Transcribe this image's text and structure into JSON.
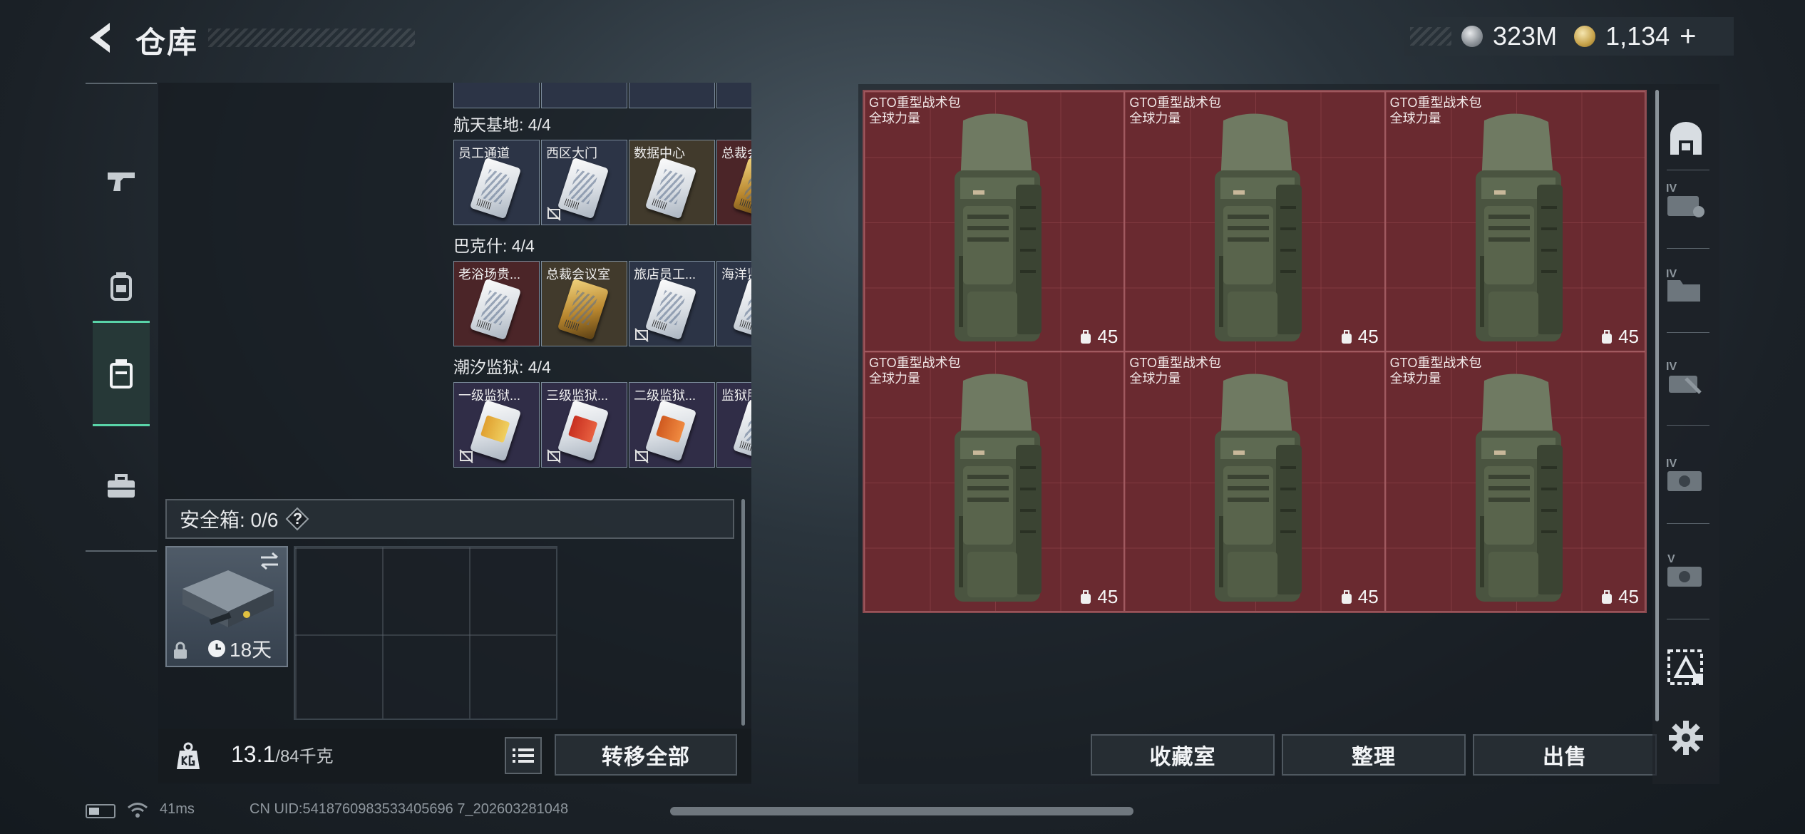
{
  "header": {
    "title": "仓库",
    "back_icon": "back-arrow-icon"
  },
  "currency": {
    "silver": "323M",
    "gold": "1,134",
    "add_label": "+",
    "silver_icon": "silver-coin-icon",
    "gold_icon": "gold-coin-icon"
  },
  "left_rail": [
    {
      "icon": "pistol-icon",
      "active": false
    },
    {
      "icon": "backpack-vest-icon",
      "active": false
    },
    {
      "icon": "container-icon",
      "active": true
    },
    {
      "icon": "toolbox-icon",
      "active": false
    }
  ],
  "keycard_sections": [
    {
      "label": "航天基地: 4/4",
      "cards": [
        {
          "name": "员工通道",
          "rarity": "blue",
          "tradeable": true
        },
        {
          "name": "西区大门",
          "rarity": "blue",
          "tradeable": false
        },
        {
          "name": "数据中心",
          "rarity": "olive",
          "tradeable": true
        },
        {
          "name": "总裁会客厅",
          "rarity": "red",
          "tradeable": true
        }
      ]
    },
    {
      "label": "巴克什: 4/4",
      "cards": [
        {
          "name": "老浴场贵...",
          "rarity": "red",
          "tradeable": true
        },
        {
          "name": "总裁会议室",
          "rarity": "olive",
          "tradeable": true
        },
        {
          "name": "旅店员工...",
          "rarity": "blue",
          "tradeable": false
        },
        {
          "name": "海洋监测厅",
          "rarity": "blue",
          "tradeable": true
        }
      ]
    },
    {
      "label": "潮汐监狱: 4/4",
      "cards": [
        {
          "name": "一级监狱...",
          "rarity": "purple",
          "tradeable": false
        },
        {
          "name": "三级监狱...",
          "rarity": "purple",
          "tradeable": false
        },
        {
          "name": "二级监狱...",
          "rarity": "purple",
          "tradeable": false
        },
        {
          "name": "监狱服务...",
          "rarity": "purple",
          "tradeable": true
        }
      ]
    }
  ],
  "safe_box": {
    "label": "安全箱: 0/6",
    "help": "?",
    "duration": "18天",
    "lock_icon": "lock-icon",
    "clock_icon": "clock-icon",
    "swap_icon": "swap-icon"
  },
  "weight": {
    "current": "13.1",
    "max": "/84千克",
    "icon": "kg-weight-icon"
  },
  "buttons": {
    "transfer_all": "转移全部",
    "collection": "收藏室",
    "sort": "整理",
    "sell": "出售"
  },
  "items": [
    {
      "name": "GTO重型战术包",
      "subtitle": "全球力量",
      "count": "45"
    },
    {
      "name": "GTO重型战术包",
      "subtitle": "全球力量",
      "count": "45"
    },
    {
      "name": "GTO重型战术包",
      "subtitle": "全球力量",
      "count": "45"
    },
    {
      "name": "GTO重型战术包",
      "subtitle": "全球力量",
      "count": "45"
    },
    {
      "name": "GTO重型战术包",
      "subtitle": "全球力量",
      "count": "45"
    },
    {
      "name": "GTO重型战术包",
      "subtitle": "全球力量",
      "count": "45"
    }
  ],
  "right_rail": [
    {
      "icon": "stash-icon"
    },
    {
      "icon": "stash-iv-1-icon",
      "label": "IV"
    },
    {
      "icon": "stash-iv-2-icon",
      "label": "IV"
    },
    {
      "icon": "stash-iv-3-icon",
      "label": "IV"
    },
    {
      "icon": "stash-iv-4-icon",
      "label": "IV"
    },
    {
      "icon": "stash-v-icon",
      "label": "V"
    },
    {
      "icon": "special-stash-icon"
    },
    {
      "icon": "settings-gear-icon"
    }
  ],
  "status_bar": {
    "ping": "41ms",
    "uid": "CN UID:5418760983533405696 7_202603281048"
  },
  "colors": {
    "accent": "#59d4a8",
    "item_bg": "#6a2a30",
    "rarity_blue": "#2c3446",
    "rarity_olive": "#413a2c",
    "rarity_red": "#4b2528",
    "rarity_purple": "#302d47"
  }
}
